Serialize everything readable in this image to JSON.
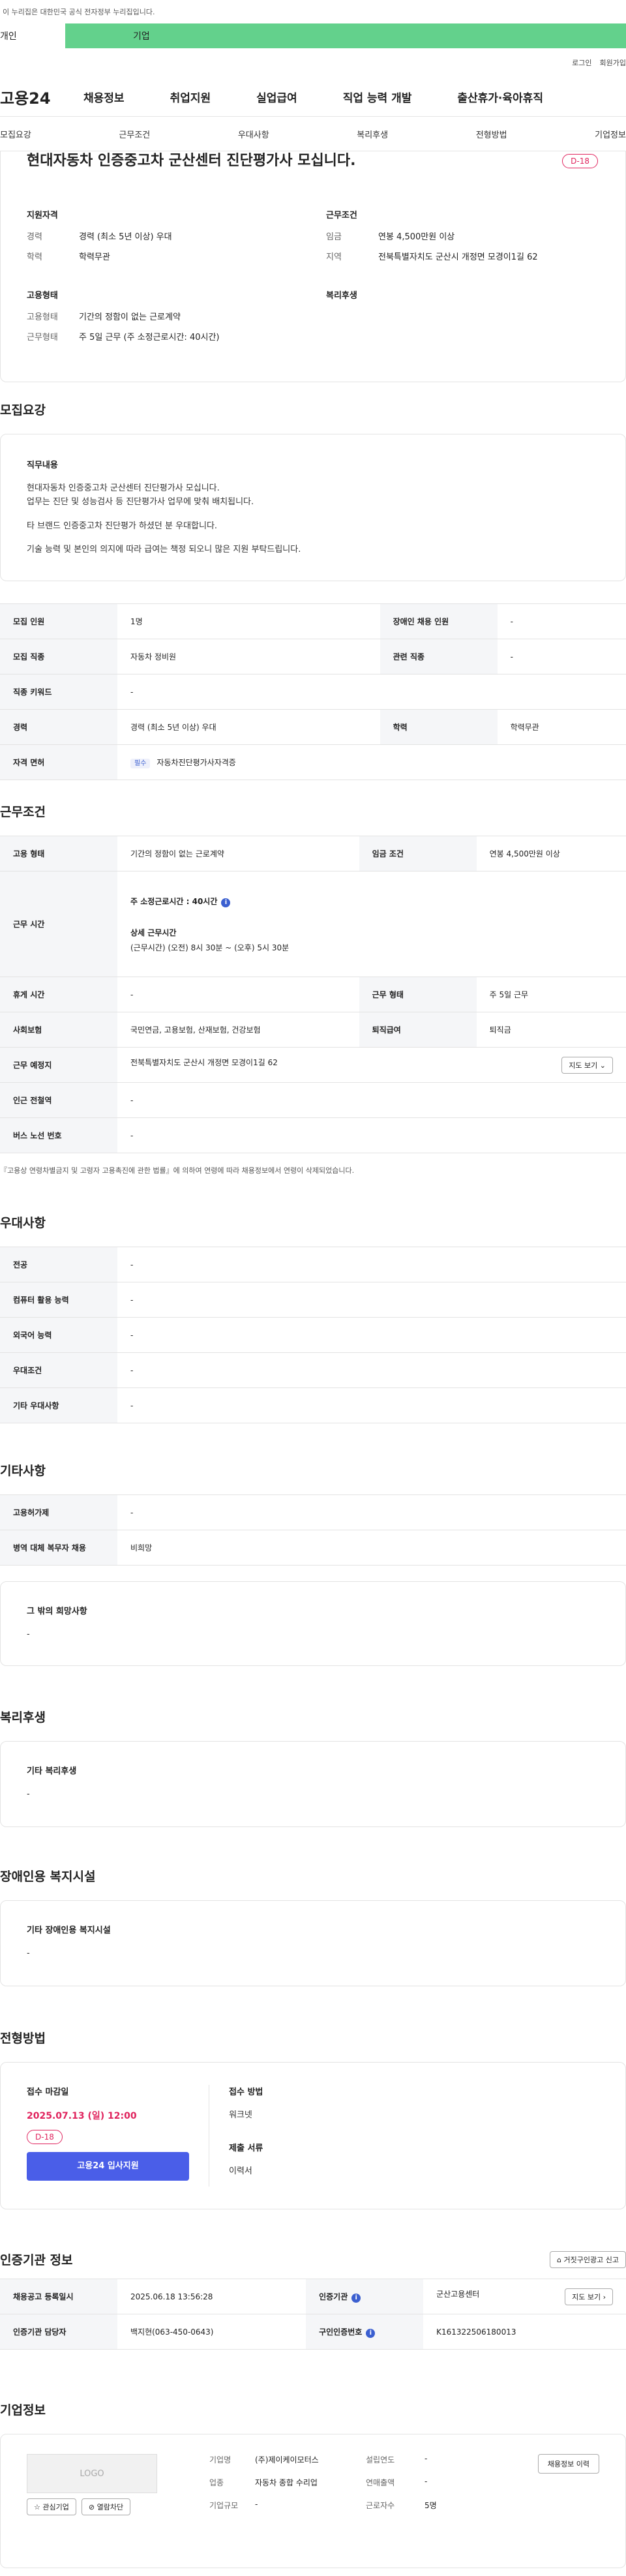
{
  "topbar": {
    "text": "이 누리집은 대한민국 공식 전자정부 누리집입니다."
  },
  "tabs": {
    "individual": "개인",
    "business": "기업"
  },
  "util": {
    "login": "로그인",
    "join": "회원가입"
  },
  "gnb": {
    "logo": "고용24",
    "items": [
      "채용정보",
      "취업지원",
      "실업급여",
      "직업 능력 개발",
      "출산휴가·육아휴직"
    ]
  },
  "subnav": [
    "모집요강",
    "근무조건",
    "우대사항",
    "복리후생",
    "전형방법",
    "기업정보"
  ],
  "summary": {
    "title": "현대자동차 인증중고차 군산센터 진단평가사 모십니다.",
    "dday": "D-18",
    "qual_h": "지원자격",
    "career_l": "경력",
    "career_v": "경력 (최소 5년 이상) 우대",
    "edu_l": "학력",
    "edu_v": "학력무관",
    "cond_h": "근무조건",
    "wage_l": "임금",
    "wage_v": "연봉 4,500만원 이상",
    "region_l": "지역",
    "region_v": "전북특별자치도 군산시 개정면 모경이1길 62",
    "emp_h": "고용형태",
    "emptype_l": "고용형태",
    "emptype_v": "기간의 정함이 없는 근로계약",
    "worktype_l": "근무형태",
    "worktype_v": "주 5일 근무 (주 소정근로시간: 40시간)",
    "welfare_h": "복리후생"
  },
  "recruit": {
    "title": "모집요강",
    "duty_h": "직무내용",
    "duty_lines": [
      "현대자동차 인증중고차 군산센터 진단평가사 모십니다.",
      "업무는 진단 및 성능검사 등 진단평가사 업무에 맞춰 배치됩니다.",
      "타 브랜드 인증중고차 진단평가 하셨던 분 우대합니다.",
      "기술 능력 및 본인의 의지에 따라 급여는 책정 되오니 많은 지원 부탁드립니다."
    ],
    "r1": {
      "h1": "모집 인원",
      "v1": "1명",
      "h2": "장애인 채용 인원",
      "v2": "-"
    },
    "r2": {
      "h1": "모집 직종",
      "v1": "자동차 정비원",
      "h2": "관련 직종",
      "v2": "-"
    },
    "r3": {
      "h1": "직종 키워드",
      "v1": "-"
    },
    "r4": {
      "h1": "경력",
      "v1": "경력 (최소 5년 이상) 우대",
      "h2": "학력",
      "v2": "학력무관"
    },
    "r5": {
      "h1": "자격 면허",
      "tag": "필수",
      "v1": "자동차진단평가사자격증"
    }
  },
  "cond": {
    "title": "근무조건",
    "r1": {
      "h1": "고용 형태",
      "v1": "기간의 정함이 없는 근로계약",
      "h2": "임금 조건",
      "v2": "연봉 4,500만원 이상"
    },
    "r2": {
      "h1": "근무 시간",
      "v1a": "주 소정근로시간 : 40시간",
      "v1b": "상세 근무시간",
      "v1c": "(근무시간) (오전) 8시 30분 ~ (오후) 5시 30분"
    },
    "r3": {
      "h1": "휴게 시간",
      "v1": "-",
      "h2": "근무 형태",
      "v2": "주 5일 근무"
    },
    "r4": {
      "h1": "사회보험",
      "v1": "국민연금, 고용보험, 산재보험, 건강보험",
      "h2": "퇴직급여",
      "v2": "퇴직금"
    },
    "r5": {
      "h1": "근무 예정지",
      "v1": "전북특별자치도 군산시 개정면 모경이1길 62",
      "btn": "지도 보기"
    },
    "r6": {
      "h1": "인근 전철역",
      "v1": "-"
    },
    "r7": {
      "h1": "버스 노선 번호",
      "v1": "-"
    },
    "note": "『고용상 연령차별금지 및 고령자 고용촉진에 관한 법률』에 의하여 연령에 따라 채용정보에서 연령이 삭제되었습니다."
  },
  "pref": {
    "title": "우대사항",
    "rows": [
      [
        "전공",
        "-"
      ],
      [
        "컴퓨터 활용 능력",
        "-"
      ],
      [
        "외국어 능력",
        "-"
      ],
      [
        "우대조건",
        "-"
      ],
      [
        "기타 우대사항",
        "-"
      ]
    ]
  },
  "etc": {
    "title": "기타사항",
    "rows": [
      [
        "고용허가제",
        "-"
      ],
      [
        "병역 대체 복무자 채용",
        "비희망"
      ]
    ],
    "box_h": "그 밖의 희망사항",
    "box_v": "-"
  },
  "welfare": {
    "title": "복리후생",
    "box_h": "기타 복리후생",
    "box_v": "-"
  },
  "disab": {
    "title": "장애인용 복지시설",
    "box_h": "기타 장애인용 복지시설",
    "box_v": "-"
  },
  "process": {
    "title": "전형방법",
    "deadline_h": "접수 마감일",
    "deadline_v": "2025.07.13 (일) 12:00",
    "dday": "D-18",
    "apply_btn": "고용24 입사지원",
    "method_h": "접수 방법",
    "method_v": "워크넷",
    "docs_h": "제출 서류",
    "docs_v": "이력서"
  },
  "agency": {
    "title": "인증기관 정보",
    "report_btn": "거짓구인광고 신고",
    "r1": {
      "h1": "채용공고 등록일시",
      "v1": "2025.06.18 13:56:28",
      "h2": "인증기관",
      "v2": "군산고용센터",
      "btn": "지도 보기"
    },
    "r2": {
      "h1": "인증기관 담당자",
      "v1": "백지현(063-450-0643)",
      "h2": "구인인증번호",
      "v2": "K161322506180013"
    }
  },
  "company": {
    "title": "기업정보",
    "logo": "LOGO",
    "fav_btn": "관심기업",
    "block_btn": "열람차단",
    "name_l": "기업명",
    "name_v": "(주)제이케이모터스",
    "ind_l": "업종",
    "ind_v": "자동차 종합 수리업",
    "size_l": "기업규모",
    "size_v": "-",
    "year_l": "설립연도",
    "year_v": "-",
    "sales_l": "연매출액",
    "sales_v": "-",
    "emp_l": "근로자수",
    "emp_v": "5명",
    "history_btn": "채용정보 이력"
  }
}
